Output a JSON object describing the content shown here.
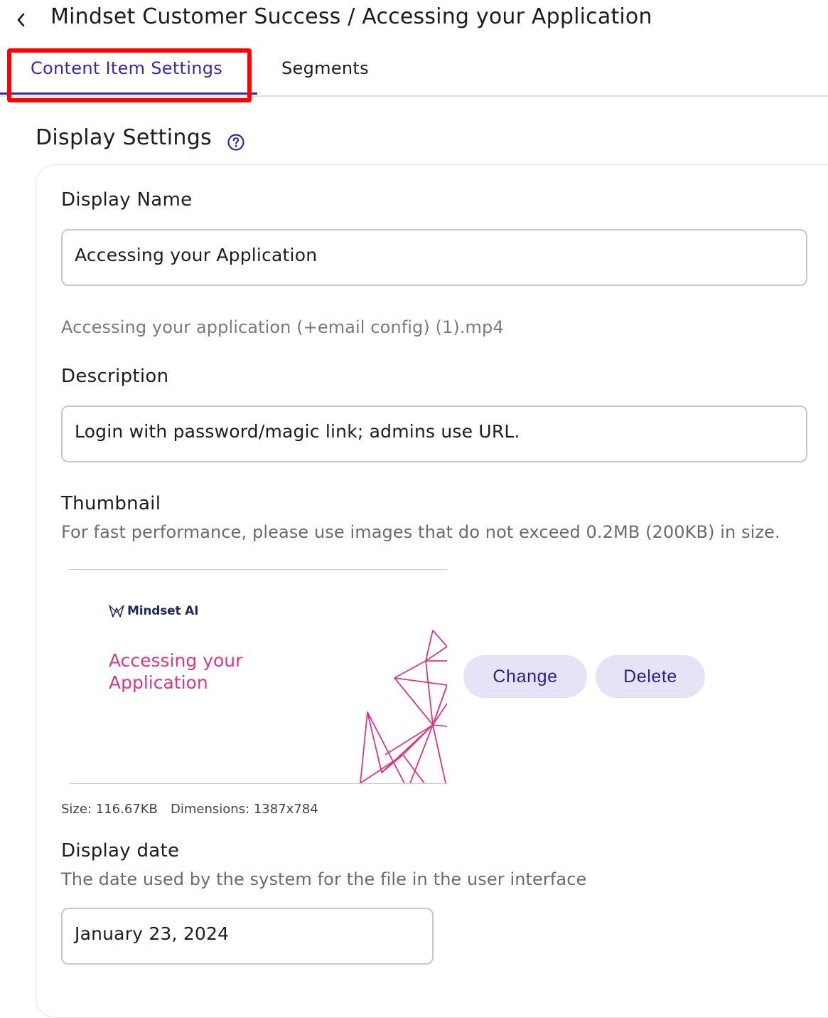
{
  "header": {
    "back_label": "‹",
    "title": "Mindset Customer Success / Accessing your Application"
  },
  "tabs": [
    {
      "label": "Content Item Settings",
      "active": true
    },
    {
      "label": "Segments",
      "active": false
    }
  ],
  "display_settings": {
    "title": "Display Settings",
    "help_icon": "help-circle-icon",
    "display_name": {
      "label": "Display Name",
      "value": "Accessing your Application"
    },
    "source_file": "Accessing your application (+email config) (1).mp4",
    "description": {
      "label": "Description",
      "value": "Login with password/magic link; admins use URL."
    },
    "thumbnail": {
      "label": "Thumbnail",
      "helper": "For fast performance, please use images that do not exceed 0.2MB (200KB) in size.",
      "image": {
        "logo_text": "Mindset AI",
        "title_line1": "Accessing your",
        "title_line2": "Application"
      },
      "change_label": "Change",
      "delete_label": "Delete",
      "size_text": "Size: 116.67KB",
      "dimensions_text": "Dimensions: 1387x784"
    },
    "display_date": {
      "label": "Display date",
      "helper": "The date used by the system for the file in the user interface",
      "value": "January 23, 2024"
    }
  },
  "colors": {
    "accent": "#3a2a9c",
    "highlight": "#ff0000",
    "thumbnail_pink": "#d33b86",
    "button_bg": "#e6e3f6"
  }
}
